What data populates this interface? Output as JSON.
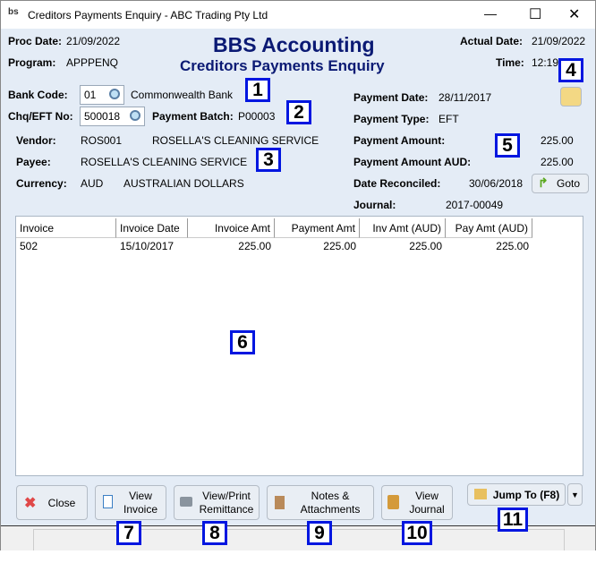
{
  "window": {
    "title": "Creditors Payments Enquiry - ABC Trading Pty Ltd",
    "minimize": "—",
    "maximize": "☐",
    "close": "✕"
  },
  "header": {
    "proc_date_label": "Proc Date:",
    "proc_date": "21/09/2022",
    "program_label": "Program:",
    "program": "APPPENQ",
    "app_title": "BBS Accounting",
    "screen_title": "Creditors Payments Enquiry",
    "actual_date_label": "Actual Date:",
    "actual_date": "21/09/2022",
    "time_label": "Time:",
    "time": "12:19"
  },
  "form": {
    "bank_code_label": "Bank Code:",
    "bank_code": "01",
    "bank_name": "Commonwealth Bank",
    "chq_label": "Chq/EFT No:",
    "chq_no": "500018",
    "batch_label": "Payment Batch:",
    "batch": "P00003",
    "vendor_label": "Vendor:",
    "vendor_code": "ROS001",
    "vendor_name": "ROSELLA'S CLEANING SERVICE",
    "payee_label": "Payee:",
    "payee": "ROSELLA'S CLEANING SERVICE",
    "currency_label": "Currency:",
    "currency_code": "AUD",
    "currency_name": "AUSTRALIAN DOLLARS",
    "payment_date_label": "Payment Date:",
    "payment_date": "28/11/2017",
    "payment_type_label": "Payment Type:",
    "payment_type": "EFT",
    "payment_amount_label": "Payment Amount:",
    "payment_amount": "225.00",
    "payment_amount_aud_label": "Payment Amount AUD:",
    "payment_amount_aud": "225.00",
    "date_reconciled_label": "Date Reconciled:",
    "date_reconciled": "30/06/2018",
    "goto_label": "Goto",
    "journal_label": "Journal:",
    "journal": "2017-00049"
  },
  "table": {
    "columns": [
      "Invoice",
      "Invoice Date",
      "Invoice Amt",
      "Payment Amt",
      "Inv Amt (AUD)",
      "Pay Amt (AUD)"
    ],
    "rows": [
      [
        "502",
        "15/10/2017",
        "225.00",
        "225.00",
        "225.00",
        "225.00"
      ]
    ]
  },
  "buttons": {
    "close": "Close",
    "view_invoice_1": "View",
    "view_invoice_2": "Invoice",
    "remit_1": "View/Print",
    "remit_2": "Remittance",
    "notes_1": "Notes &",
    "notes_2": "Attachments",
    "journal_1": "View",
    "journal_2": "Journal",
    "jump": "Jump To (F8)",
    "jump_arrow": "▼"
  },
  "badges": [
    "1",
    "2",
    "3",
    "4",
    "5",
    "6",
    "7",
    "8",
    "9",
    "10",
    "11"
  ],
  "colors": {
    "title": "#0b1a74",
    "background": "#e4ecf6",
    "badge_border": "#0016e0"
  }
}
